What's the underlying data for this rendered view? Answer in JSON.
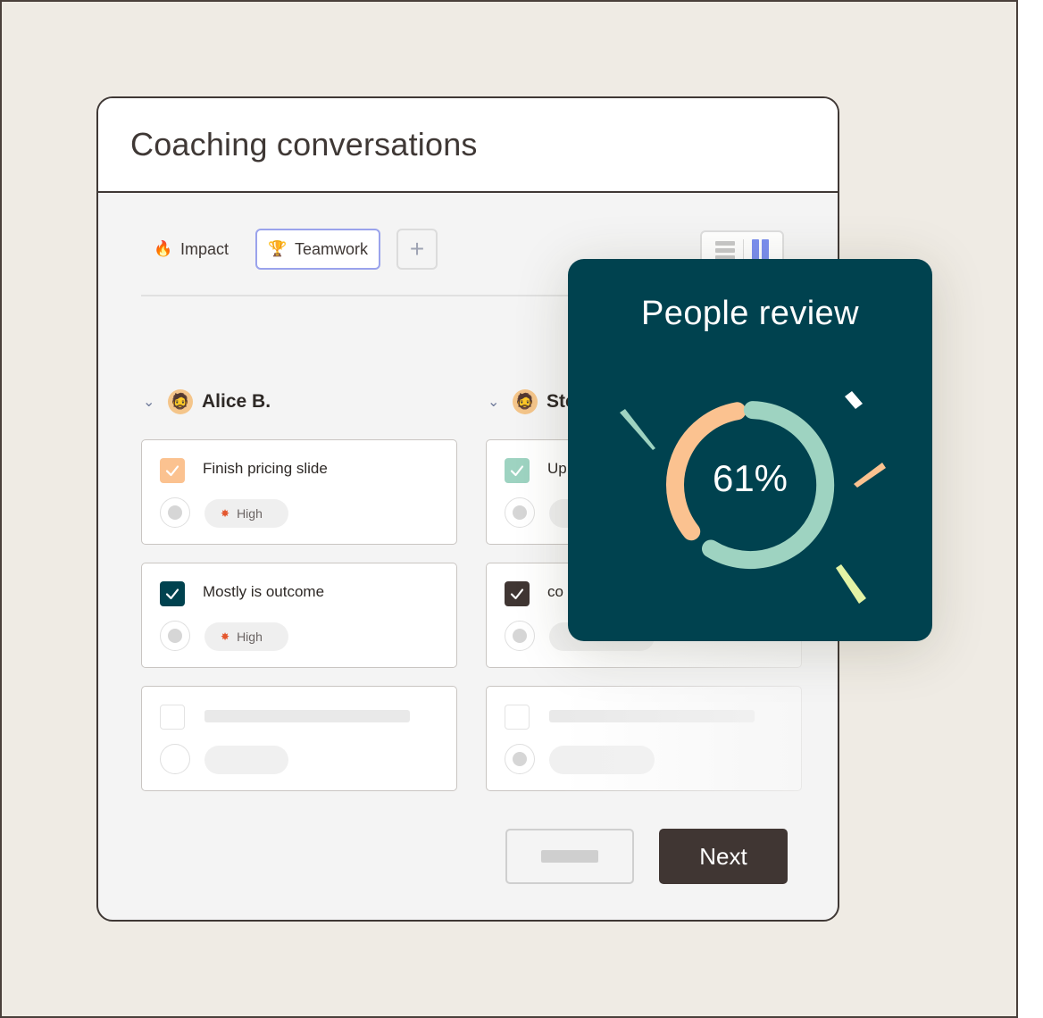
{
  "window": {
    "title": "Coaching conversations"
  },
  "tabs": [
    {
      "label": "Impact",
      "icon": "fire-icon"
    },
    {
      "label": "Teamwork",
      "icon": "trophy-icon",
      "active": true
    }
  ],
  "columns": [
    {
      "name": "Alice B.",
      "avatar": "avatar-alice",
      "cards": [
        {
          "text": "Finish pricing slide",
          "checked": true,
          "color": "#fbc290",
          "priority": "High"
        },
        {
          "text": "Mostly is outcome",
          "checked": true,
          "color": "#00424f",
          "priority": "High"
        },
        {
          "text": "",
          "checked": false,
          "placeholder": true
        }
      ]
    },
    {
      "name": "Ste",
      "avatar": "avatar-ste",
      "cards": [
        {
          "text": "Up",
          "checked": true,
          "color": "#9ed3c1",
          "priority": ""
        },
        {
          "text": "co",
          "checked": true,
          "color": "#403633",
          "priority": ""
        },
        {
          "text": "",
          "checked": false,
          "placeholder": true
        }
      ]
    }
  ],
  "buttons": {
    "next": "Next"
  },
  "overlay": {
    "title": "People review",
    "percent_label": "61%",
    "percent_value": 0.61,
    "colors": {
      "background": "#00424f",
      "progress": "#9ed3c1",
      "remaining": "#fbc290"
    }
  }
}
